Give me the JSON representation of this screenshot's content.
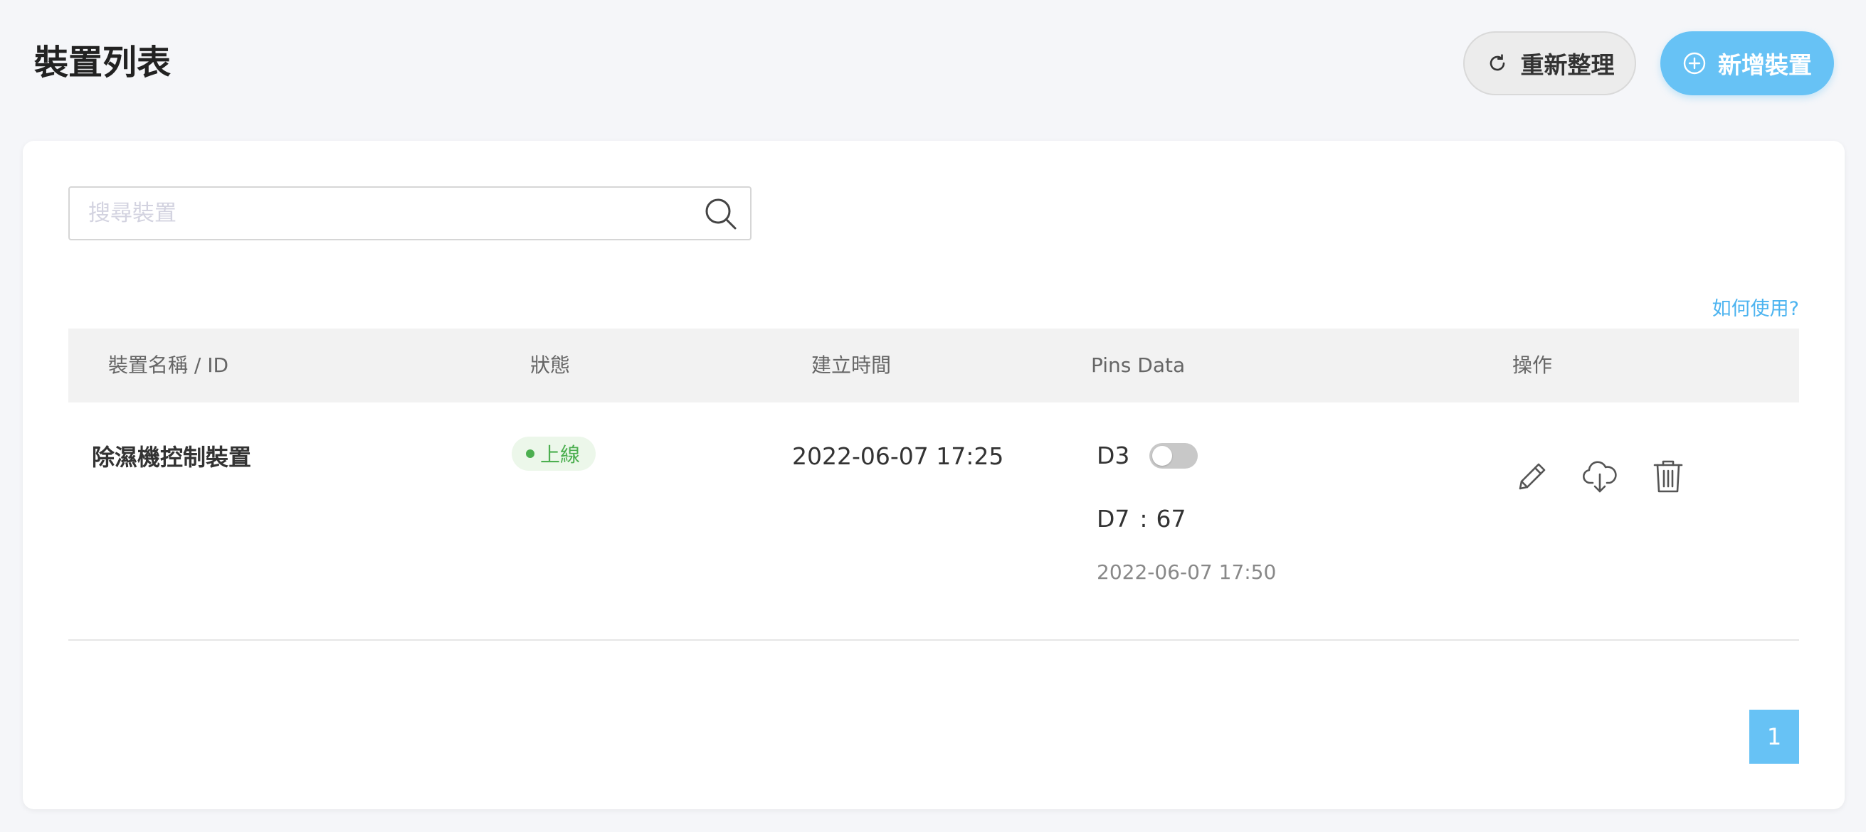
{
  "header": {
    "title": "裝置列表",
    "refresh_label": "重新整理",
    "add_label": "新增裝置",
    "refresh_icon": "refresh-icon",
    "add_icon": "plus-circle-icon"
  },
  "search": {
    "placeholder": "搜尋裝置",
    "value": "",
    "icon": "search-icon"
  },
  "help_link": "如何使用?",
  "table": {
    "columns": [
      "裝置名稱 / ID",
      "狀態",
      "建立時間",
      "Pins Data",
      "操作"
    ],
    "rows": [
      {
        "name": "除濕機控制裝置",
        "status": "上線",
        "created": "2022-06-07 17:25",
        "pins": {
          "d3_label": "D3",
          "d3_on": false,
          "d7_label": "D7",
          "d7_sep": ":",
          "d7_value": "67",
          "updated": "2022-06-07 17:50"
        },
        "actions": [
          "pencil-icon",
          "cloud-download-icon",
          "trash-icon"
        ]
      }
    ]
  },
  "pagination": {
    "current": "1"
  },
  "colors": {
    "accent": "#67c2f5",
    "link": "#4db4f0",
    "online": "#4caf50",
    "online_bg": "#ecf7ea"
  }
}
